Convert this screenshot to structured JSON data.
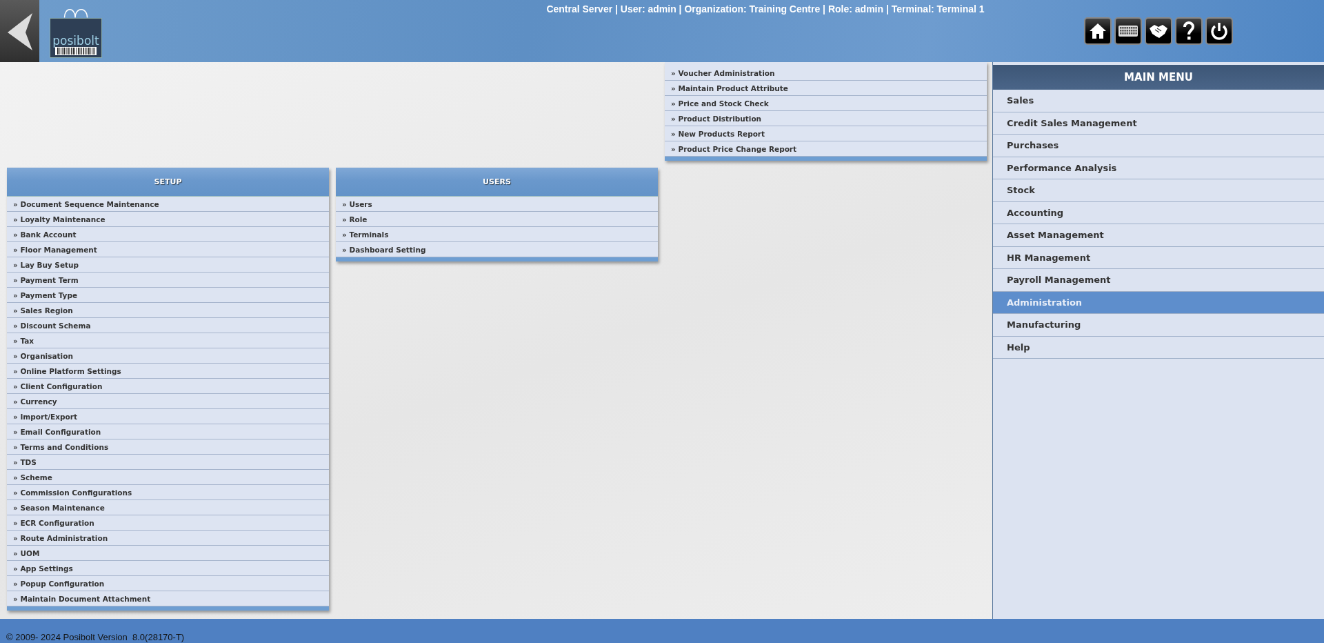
{
  "header": {
    "logo_text": "posibolt",
    "session_info": "Central Server | User: admin | Organization: Training Centre | Role: admin | Terminal: Terminal 1"
  },
  "top_panel": {
    "items": [
      "» Voucher Administration",
      "» Maintain Product Attribute",
      "» Price and Stock Check",
      "» Product Distribution",
      "» New Products Report",
      "» Product Price Change Report"
    ]
  },
  "setup_panel": {
    "title": "SETUP",
    "items": [
      "» Document Sequence Maintenance",
      "» Loyalty Maintenance",
      "» Bank Account",
      "» Floor Management",
      "» Lay Buy Setup",
      "» Payment Term",
      "» Payment Type",
      "» Sales Region",
      "» Discount Schema",
      "» Tax",
      "» Organisation",
      "» Online Platform Settings",
      "» Client Configuration",
      "» Currency",
      "» Import/Export",
      "» Email Configuration",
      "» Terms and Conditions",
      "» TDS",
      "» Scheme",
      "» Commission Configurations",
      "» Season Maintenance",
      "» ECR Configuration",
      "» Route Administration",
      "» UOM",
      "» App Settings",
      "» Popup Configuration",
      "» Maintain Document Attachment"
    ]
  },
  "users_panel": {
    "title": "USERS",
    "items": [
      "» Users",
      "» Role",
      "» Terminals",
      "» Dashboard Setting"
    ]
  },
  "main_menu": {
    "title": "MAIN MENU",
    "items": [
      {
        "label": "Sales",
        "selected": false
      },
      {
        "label": "Credit Sales Management",
        "selected": false
      },
      {
        "label": "Purchases",
        "selected": false
      },
      {
        "label": "Performance Analysis",
        "selected": false
      },
      {
        "label": "Stock",
        "selected": false
      },
      {
        "label": "Accounting",
        "selected": false
      },
      {
        "label": "Asset Management",
        "selected": false
      },
      {
        "label": "HR Management",
        "selected": false
      },
      {
        "label": "Payroll Management",
        "selected": false
      },
      {
        "label": "Administration",
        "selected": true
      },
      {
        "label": "Manufacturing",
        "selected": false
      },
      {
        "label": "Help",
        "selected": false
      }
    ]
  },
  "footer": {
    "text": "© 2009- 2024 Posibolt Version  8.0(28170-T)"
  }
}
